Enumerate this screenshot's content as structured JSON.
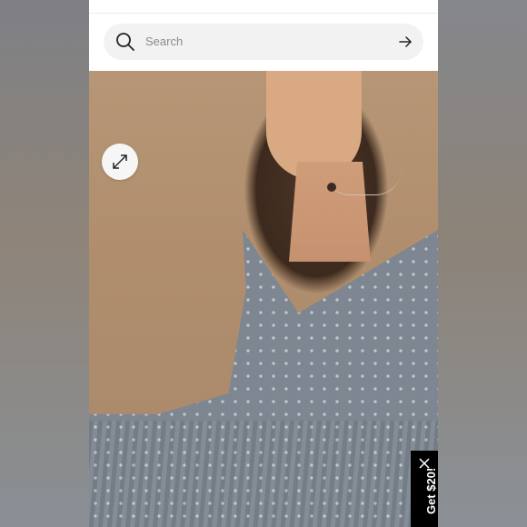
{
  "search": {
    "placeholder": "Search"
  },
  "promo_tab": {
    "label": "Get $20!"
  },
  "icons": {
    "search": "search-icon",
    "submit": "arrow-right-icon",
    "expand": "expand-icon",
    "close": "close-icon"
  },
  "colors": {
    "promo_background": "#000000",
    "search_background": "#f2f2f2",
    "dress": "#7d8691"
  }
}
